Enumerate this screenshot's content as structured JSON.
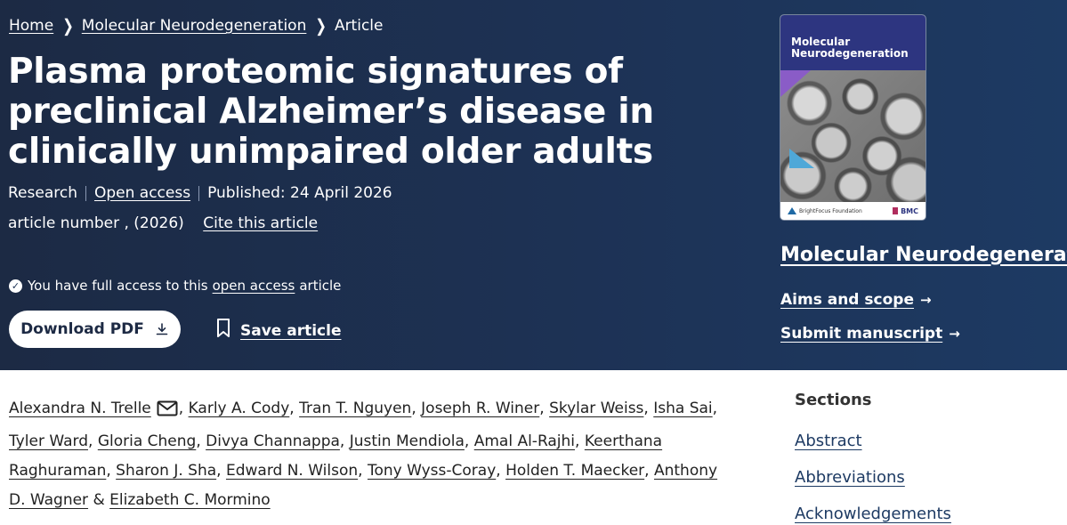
{
  "breadcrumb": {
    "home": "Home",
    "journal": "Molecular Neurodegeneration",
    "current": "Article",
    "separator_icon": "chevron-right-icon"
  },
  "article": {
    "title": "Plasma proteomic signatures of preclinical Alzheimer’s disease in clinically unimpaired older adults",
    "type": "Research",
    "access": "Open access",
    "published": "Published: 24 April 2026",
    "article_number": "article number , (2026)",
    "cite": "Cite this article"
  },
  "access_notice": {
    "prefix": "You have full access to this",
    "link": "open access",
    "suffix": "article",
    "icon": "check-circle-icon"
  },
  "actions": {
    "download": "Download PDF",
    "download_icon": "download-icon",
    "save": "Save article",
    "save_icon": "bookmark-icon"
  },
  "cover": {
    "title_line1": "Molecular",
    "title_line2": "Neurodegeneration",
    "sponsor": "BrightFocus Foundation",
    "publisher": "BMC"
  },
  "sidebar": {
    "journal": "Molecular Neurodegeneration",
    "aims": "Aims and scope",
    "submit": "Submit manuscript",
    "arrow_icon": "arrow-right-icon"
  },
  "authors": [
    "Alexandra N. Trelle",
    "Karly A. Cody",
    "Tran T. Nguyen",
    "Joseph R. Winer",
    "Skylar Weiss",
    "Isha Sai",
    "Tyler Ward",
    "Gloria Cheng",
    "Divya Channappa",
    "Justin Mendiola",
    "Amal Al-Rajhi",
    "Keerthana Raghuraman",
    "Sharon J. Sha",
    "Edward N. Wilson",
    "Tony Wyss-Coray",
    "Holden T. Maecker",
    "Anthony D. Wagner",
    "Elizabeth C. Mormino"
  ],
  "author_sep": ", ",
  "author_and": " & ",
  "sections": {
    "heading": "Sections",
    "items": [
      "Abstract",
      "Abbreviations",
      "Acknowledgements"
    ]
  },
  "colors": {
    "hero_background": "#1d3255",
    "text_dark": "#222222",
    "link_blue": "#1d3a63",
    "cover_band": "#2d3580"
  }
}
